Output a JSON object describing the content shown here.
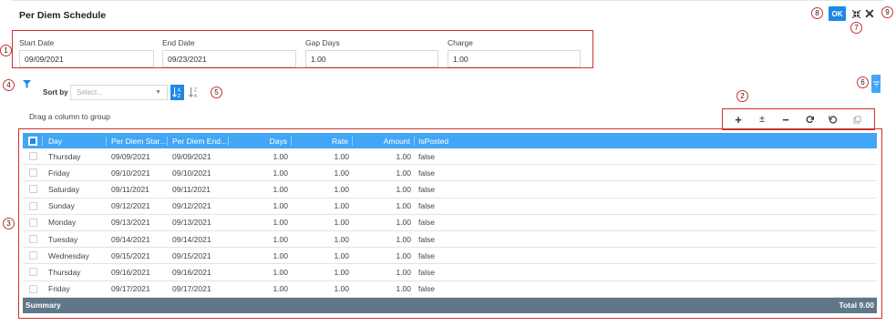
{
  "dialog": {
    "title": "Per Diem Schedule",
    "ok_label": "OK"
  },
  "callouts": [
    "1",
    "2",
    "3",
    "4",
    "5",
    "6",
    "7",
    "8",
    "9"
  ],
  "header_fields": [
    {
      "label": "Start Date",
      "value": "09/09/2021"
    },
    {
      "label": "End Date",
      "value": "09/23/2021"
    },
    {
      "label": "Gap Days",
      "value": "1.00"
    },
    {
      "label": "Charge",
      "value": "1.00"
    }
  ],
  "sort": {
    "label": "Sort by",
    "placeholder": "Select..."
  },
  "group_hint": "Drag a column to group",
  "grid": {
    "columns": [
      "Day",
      "Per Diem Star...",
      "Per Diem End...",
      "Days",
      "Rate",
      "Amount",
      "IsPosted"
    ],
    "rows": [
      [
        "Thursday",
        "09/09/2021",
        "09/09/2021",
        "1.00",
        "1.00",
        "1.00",
        "false"
      ],
      [
        "Friday",
        "09/10/2021",
        "09/10/2021",
        "1.00",
        "1.00",
        "1.00",
        "false"
      ],
      [
        "Saturday",
        "09/11/2021",
        "09/11/2021",
        "1.00",
        "1.00",
        "1.00",
        "false"
      ],
      [
        "Sunday",
        "09/12/2021",
        "09/12/2021",
        "1.00",
        "1.00",
        "1.00",
        "false"
      ],
      [
        "Monday",
        "09/13/2021",
        "09/13/2021",
        "1.00",
        "1.00",
        "1.00",
        "false"
      ],
      [
        "Tuesday",
        "09/14/2021",
        "09/14/2021",
        "1.00",
        "1.00",
        "1.00",
        "false"
      ],
      [
        "Wednesday",
        "09/15/2021",
        "09/15/2021",
        "1.00",
        "1.00",
        "1.00",
        "false"
      ],
      [
        "Thursday",
        "09/16/2021",
        "09/16/2021",
        "1.00",
        "1.00",
        "1.00",
        "false"
      ],
      [
        "Friday",
        "09/17/2021",
        "09/17/2021",
        "1.00",
        "1.00",
        "1.00",
        "false"
      ]
    ],
    "summary_label": "Summary",
    "summary_total": "Total 9.00"
  },
  "toolbar_icons": [
    "plus-icon",
    "plus-minus-icon",
    "minus-icon",
    "refresh-icon",
    "undo-icon",
    "copy-icon"
  ],
  "colors": {
    "accent": "#1e88e5",
    "header_bg": "#42a5f5",
    "summary_bg": "#5f7788",
    "callout_border": "#d32f2f"
  }
}
